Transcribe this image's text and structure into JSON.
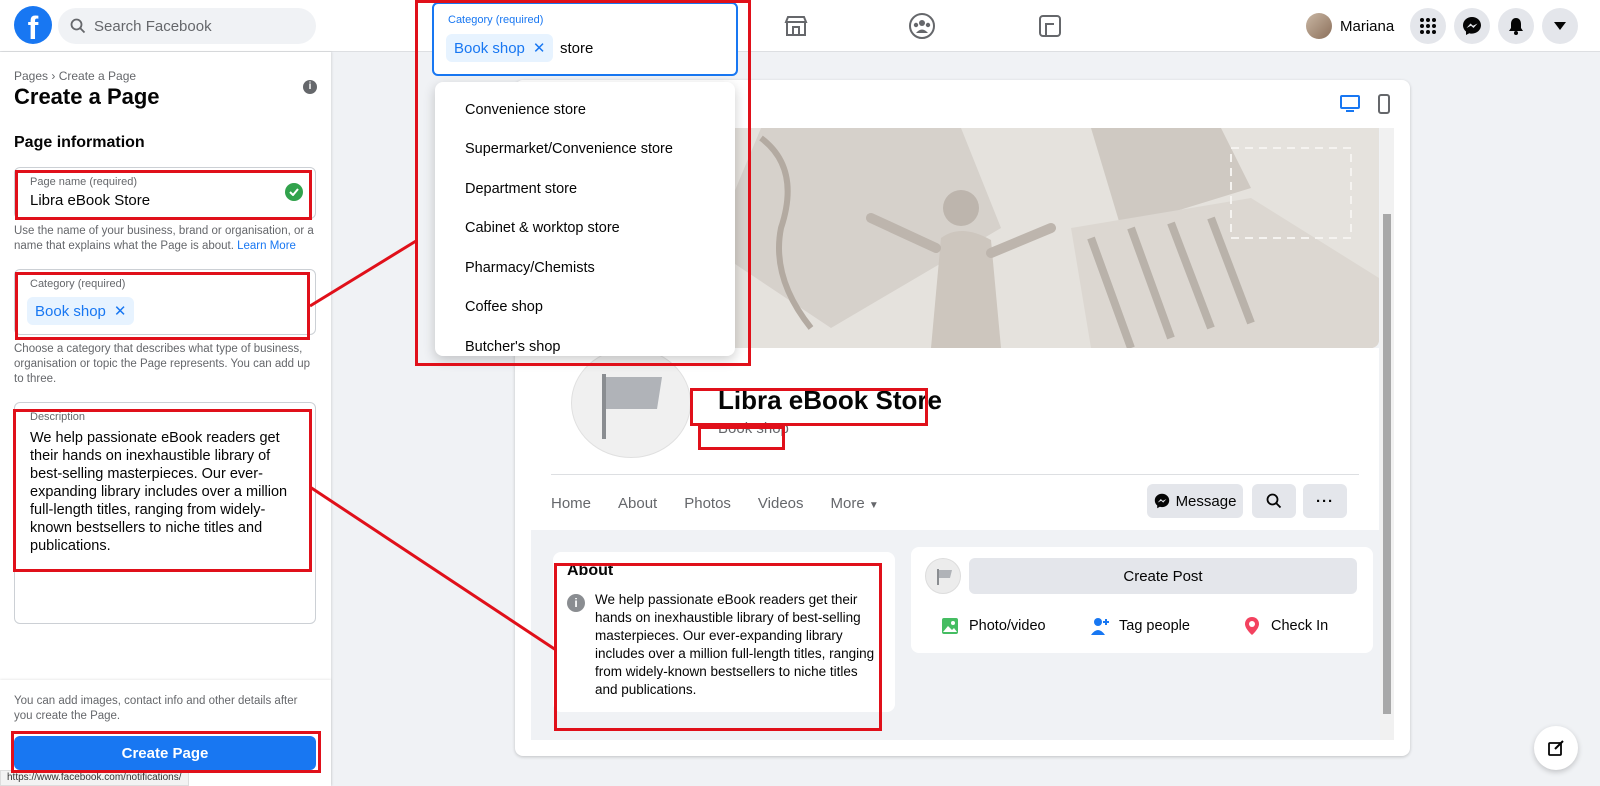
{
  "header": {
    "search_placeholder": "Search Facebook",
    "user_name": "Mariana"
  },
  "left_panel": {
    "breadcrumb": "Pages › Create a Page",
    "title": "Create a Page",
    "section_heading": "Page information",
    "page_name": {
      "label": "Page name (required)",
      "value": "Libra eBook Store",
      "helper": "Use the name of your business, brand or organisation, or a name that explains what the Page is about.",
      "helper_link": "Learn More"
    },
    "category": {
      "label": "Category (required)",
      "chip": "Book shop",
      "helper": "Choose a category that describes what type of business, organisation or topic the Page represents. You can add up to three."
    },
    "description": {
      "label": "Description",
      "value": "We help passionate eBook readers get their hands on inexhaustible library of best-selling masterpieces. Our ever-expanding library includes over a million full-length titles, ranging from widely-known bestsellers to niche titles and publications."
    },
    "footer_note": "You can add images, contact info and other details after you create the Page.",
    "create_button": "Create Page"
  },
  "status_bar_url": "https://www.facebook.com/notifications/",
  "category_search": {
    "label": "Category (required)",
    "chip": "Book shop",
    "query": "store",
    "options": [
      "Convenience store",
      "Supermarket/Convenience store",
      "Department store",
      "Cabinet & worktop store",
      "Pharmacy/Chemists",
      "Coffee shop",
      "Butcher's shop"
    ]
  },
  "preview": {
    "page_name": "Libra eBook Store",
    "category": "Book shop",
    "tabs": [
      "Home",
      "About",
      "Photos",
      "Videos",
      "More"
    ],
    "message_button": "Message",
    "about": {
      "heading": "About",
      "text": "We help passionate eBook readers get their hands on inexhaustible library of best-selling masterpieces. Our ever-expanding library includes over a million full-length titles, ranging from widely-known bestsellers to niche titles and publications."
    },
    "create_post": "Create Post",
    "post_actions": [
      "Photo/video",
      "Tag people",
      "Check In"
    ]
  },
  "colors": {
    "brand_blue": "#1877f2",
    "annotation_red": "#e0101a",
    "success_green": "#31a24c"
  }
}
